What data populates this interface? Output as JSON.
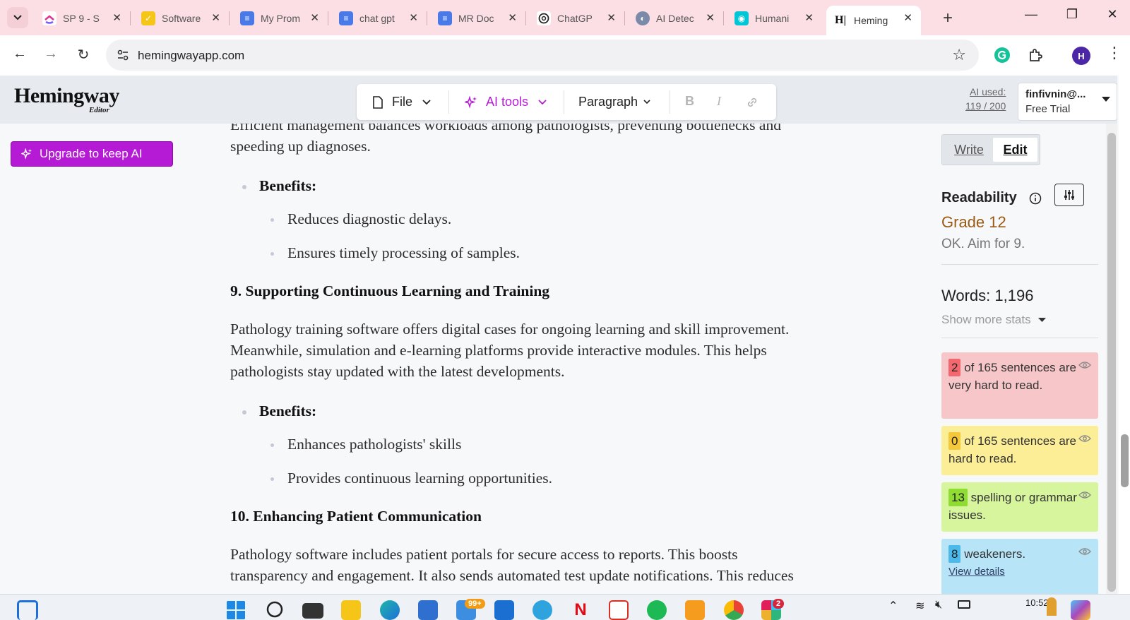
{
  "browser": {
    "tabs": [
      {
        "title": "SP 9 - S",
        "favicon": "clickup-icon",
        "color": "#ffffff"
      },
      {
        "title": "Software",
        "favicon": "check-icon",
        "color": "#f5c518"
      },
      {
        "title": "My Prom",
        "favicon": "docs-icon",
        "color": "#4a7ae8"
      },
      {
        "title": "chat gpt",
        "favicon": "docs-icon",
        "color": "#4a7ae8"
      },
      {
        "title": "MR Doc",
        "favicon": "docs-icon",
        "color": "#4a7ae8"
      },
      {
        "title": "ChatGP",
        "favicon": "openai-icon",
        "color": "#ffffff"
      },
      {
        "title": "AI Detec",
        "favicon": "brain-icon",
        "color": "#7b8aa8"
      },
      {
        "title": "Humani",
        "favicon": "humanize-icon",
        "color": "#00c6d6"
      },
      {
        "title": "Heming",
        "favicon": "hemingway-icon",
        "color": "#ffffff"
      }
    ],
    "url": "hemingwayapp.com",
    "profile_initial": "H"
  },
  "header": {
    "logo": "Hemingway",
    "logo_sub": "Editor",
    "file_label": "File",
    "ai_tools_label": "AI tools",
    "paragraph_label": "Paragraph",
    "bold_label": "B",
    "italic_label": "I",
    "ai_used_label": "AI used:",
    "ai_used_count": "119 / 200",
    "account_email": "finfivnin@...",
    "account_plan": "Free Trial"
  },
  "upgrade_label": "Upgrade to keep AI",
  "document": {
    "line1": "Efficient management balances workloads among pathologists, preventing bottlenecks and",
    "line2": "speeding up diagnoses.",
    "benefits1_label": "Benefits:",
    "benefits1_items": [
      "Reduces diagnostic delays.",
      "Ensures timely processing of samples."
    ],
    "heading9": "9. Supporting Continuous Learning and Training",
    "para9": [
      "Pathology training software offers digital cases for ongoing learning and skill improvement.",
      "Meanwhile, simulation and e-learning platforms provide interactive modules. This helps",
      "pathologists stay updated with the latest developments."
    ],
    "benefits2_label": "Benefits:",
    "benefits2_items": [
      "Enhances pathologists' skills",
      "Provides continuous learning opportunities."
    ],
    "heading10": "10. Enhancing Patient Communication",
    "para10": [
      "Pathology software includes patient portals for secure access to reports. This boosts",
      "transparency and engagement. It also sends automated test update notifications. This reduces"
    ]
  },
  "sidebar": {
    "write_label": "Write",
    "edit_label": "Edit",
    "readability_label": "Readability",
    "grade": "Grade 12",
    "grade_note": "OK. Aim for 9.",
    "words": "Words: 1,196",
    "show_more": "Show more stats",
    "cards": [
      {
        "num": "2",
        "text": "of 165 sentences are very hard to read.",
        "bg": "#f7c6c8",
        "num_bg": "#f2686e"
      },
      {
        "num": "0",
        "text": "of 165 sentences are hard to read.",
        "bg": "#fcee97",
        "num_bg": "#f5c73a"
      },
      {
        "num": "13",
        "text": "spelling or grammar issues.",
        "bg": "#d6f59c",
        "num_bg": "#8fdc33"
      },
      {
        "num": "8",
        "text": "weakeners.",
        "bg": "#b7e4f7",
        "num_bg": "#4bb9ea",
        "link": "View details"
      }
    ]
  },
  "taskbar": {
    "mail_badge": "99+",
    "slack_badge": "2",
    "time": "10:52"
  }
}
